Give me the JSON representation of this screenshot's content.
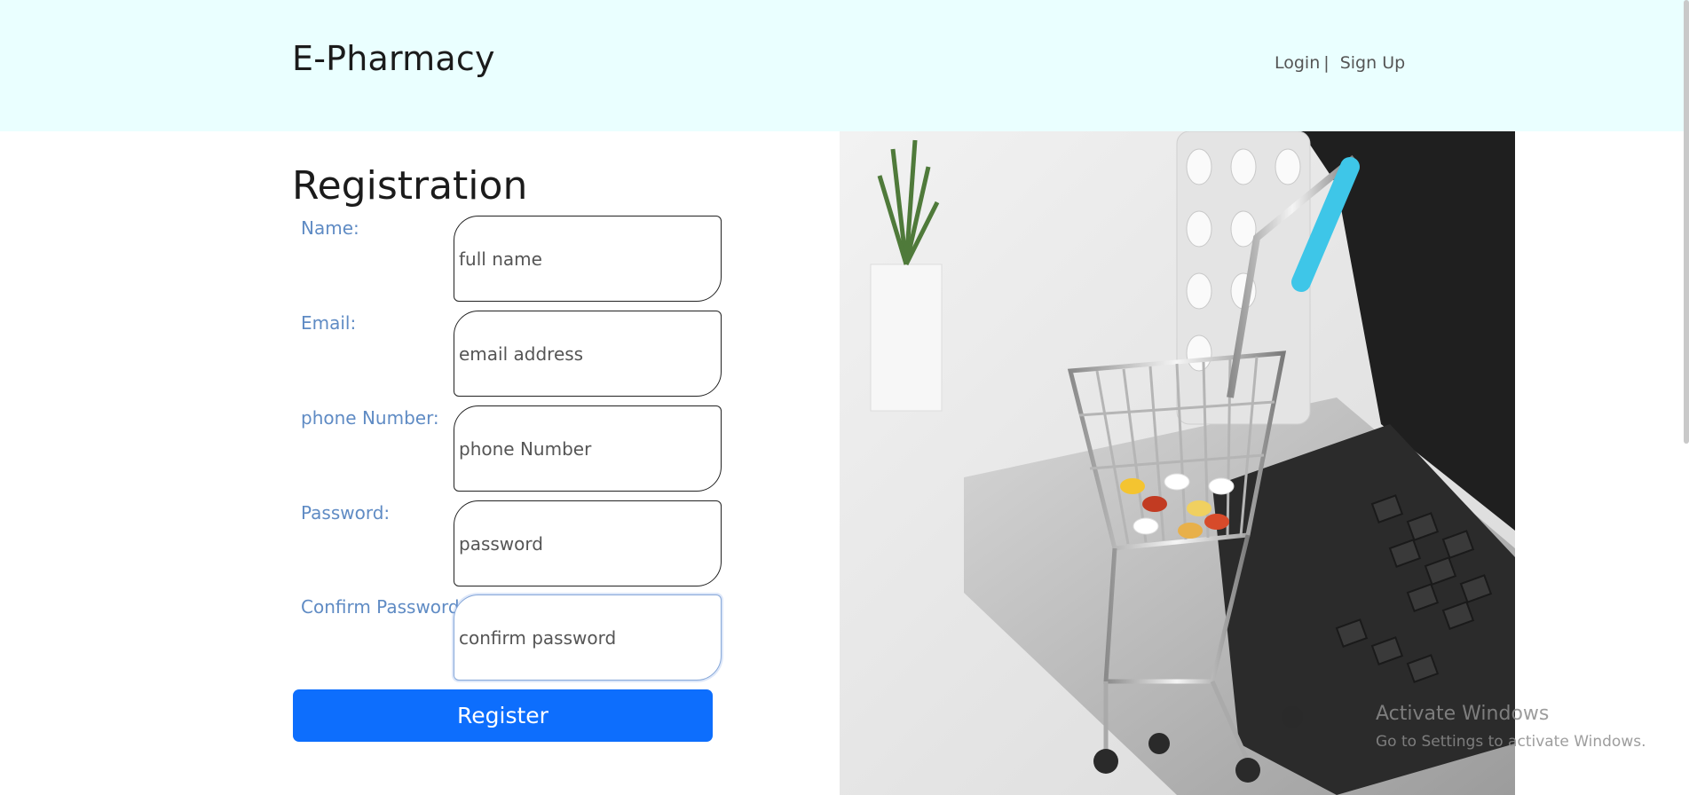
{
  "header": {
    "brand": "E-Pharmacy",
    "login": "Login",
    "separator": "|",
    "signup": "Sign Up"
  },
  "form": {
    "title": "Registration",
    "fields": [
      {
        "label": "Name:",
        "placeholder": "full name"
      },
      {
        "label": "Email:",
        "placeholder": "email address"
      },
      {
        "label": "phone Number:",
        "placeholder": "phone Number"
      },
      {
        "label": "Password:",
        "placeholder": "password"
      },
      {
        "label": "Confirm Password:",
        "placeholder": "confirm password"
      }
    ],
    "submit_label": "Register"
  },
  "hero": {
    "image_desc_icon": "shopping-cart-with-pills-on-laptop"
  },
  "watermark": {
    "title": "Activate Windows",
    "subtitle": "Go to Settings to activate Windows."
  },
  "colors": {
    "header_bg": "#eaffff",
    "label": "#5f8bc4",
    "button": "#0d6efd"
  }
}
